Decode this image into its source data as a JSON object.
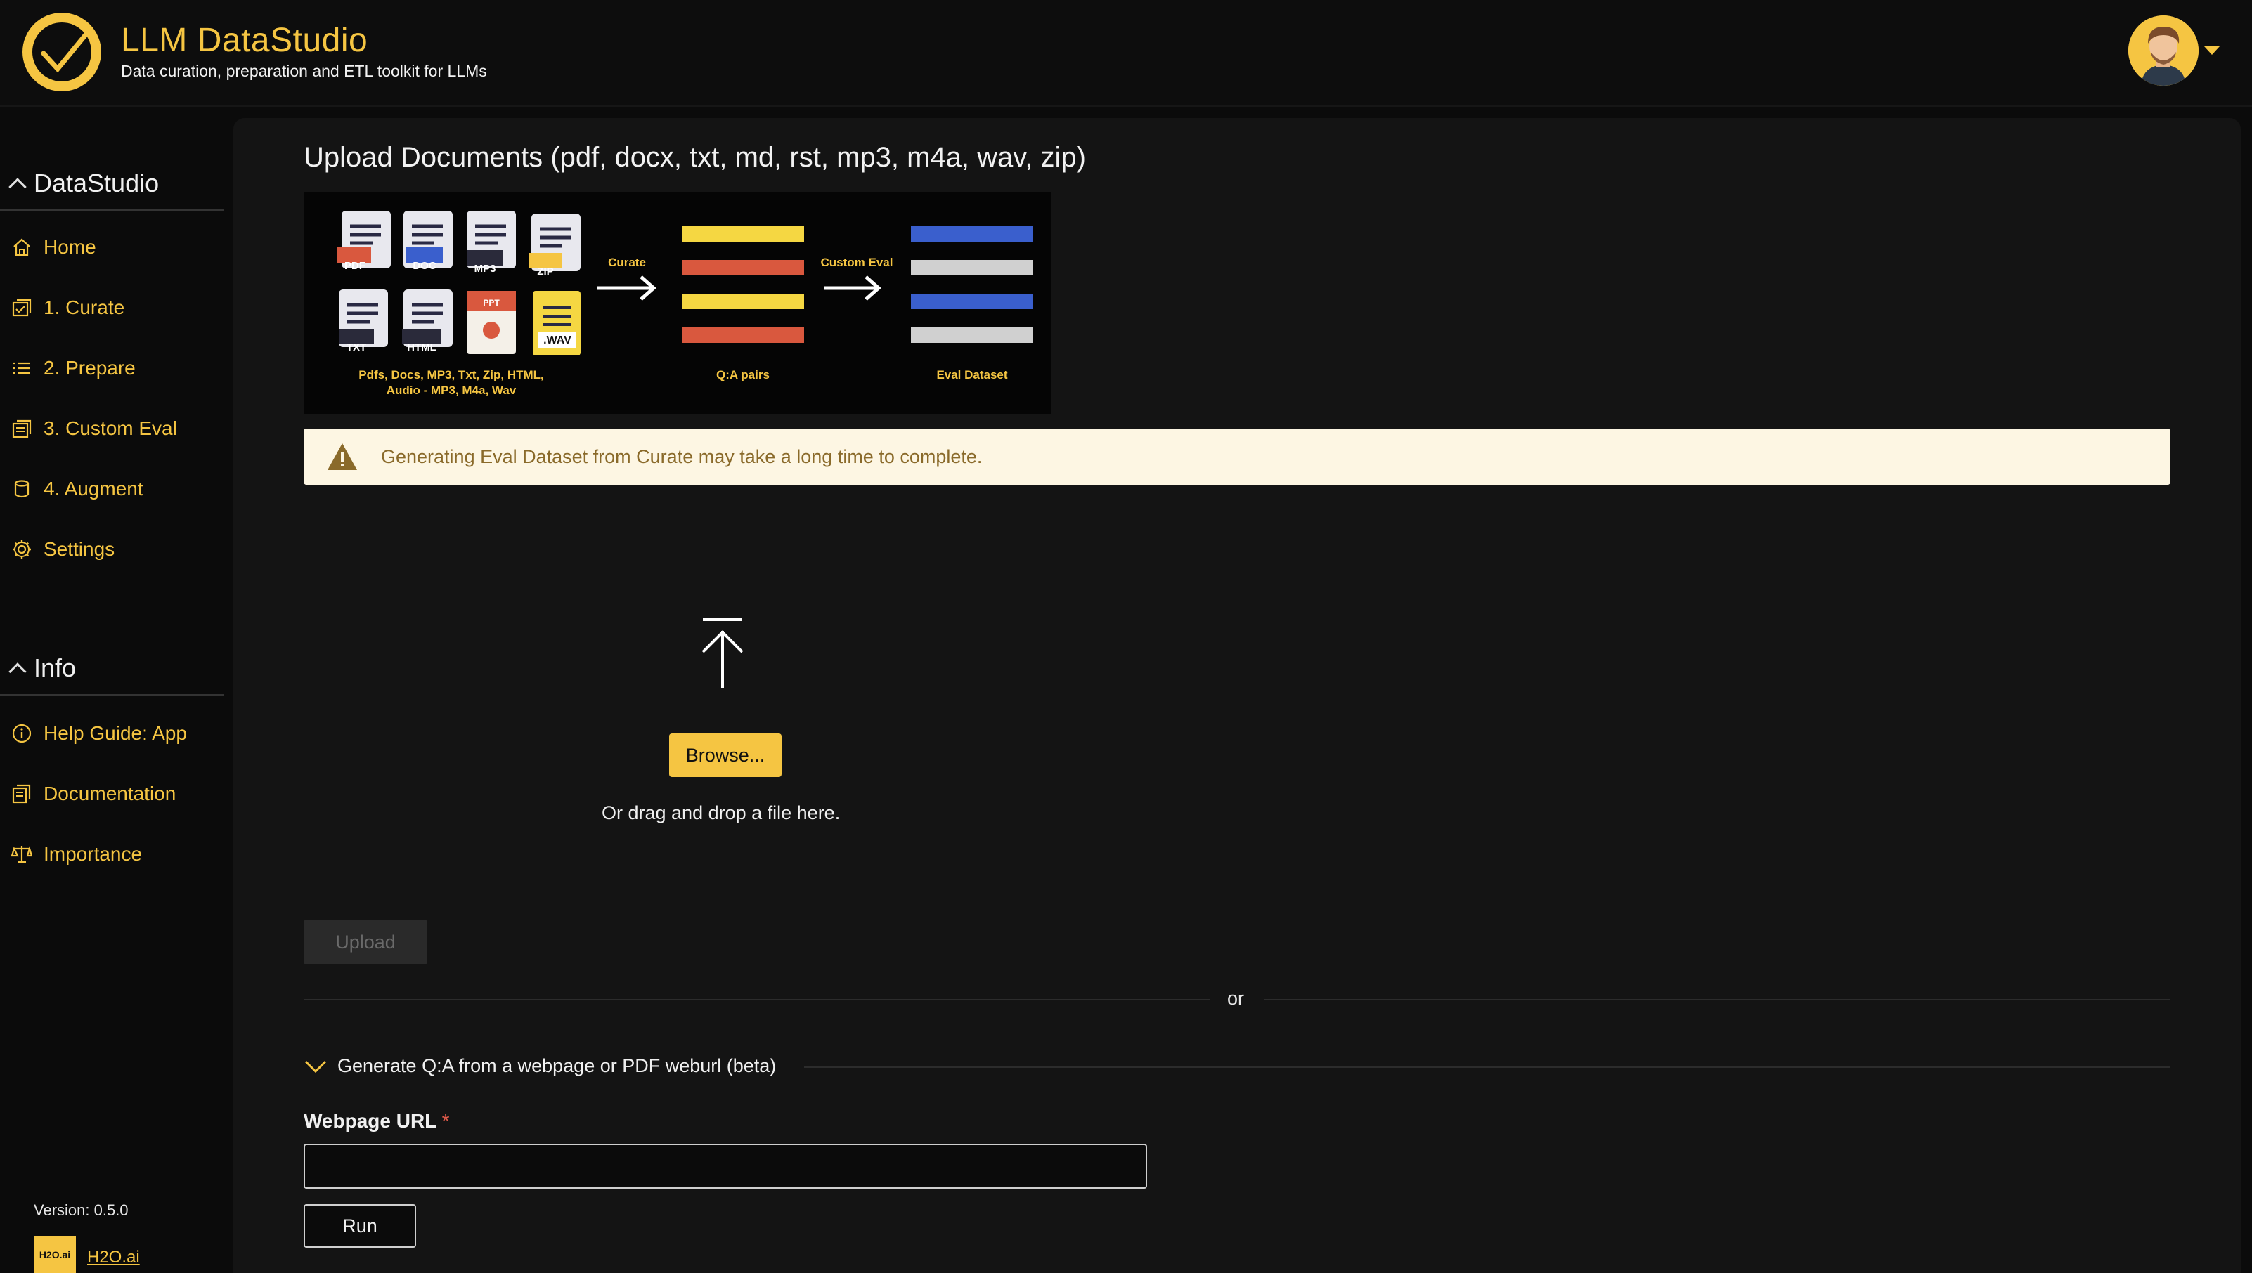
{
  "header": {
    "title": "LLM DataStudio",
    "subtitle": "Data curation, preparation and ETL toolkit for LLMs"
  },
  "sidebar": {
    "sections": [
      {
        "title": "DataStudio",
        "items": [
          {
            "label": "Home",
            "icon": "home-icon"
          },
          {
            "label": "1. Curate",
            "icon": "curate-icon"
          },
          {
            "label": "2. Prepare",
            "icon": "list-icon"
          },
          {
            "label": "3. Custom Eval",
            "icon": "eval-icon"
          },
          {
            "label": "4. Augment",
            "icon": "database-icon"
          },
          {
            "label": "Settings",
            "icon": "gear-icon"
          }
        ]
      },
      {
        "title": "Info",
        "items": [
          {
            "label": "Help Guide: App",
            "icon": "info-icon"
          },
          {
            "label": "Documentation",
            "icon": "document-icon"
          },
          {
            "label": "Importance",
            "icon": "scale-icon"
          }
        ]
      }
    ],
    "version": "Version: 0.5.0",
    "brand_badge": "H2O.ai",
    "brand_link": "H2O.ai"
  },
  "main": {
    "title": "Upload Documents (pdf, docx, txt, md, rst, mp3, m4a, wav, zip)",
    "banner": {
      "file_tags": [
        "PDF",
        "DOC",
        "MP3",
        "ZIP",
        "TXT",
        "HTML",
        "PPT",
        ".WAV"
      ],
      "arrow1": "Curate",
      "arrow2": "Custom Eval",
      "caption_sources": "Pdfs, Docs, MP3, Txt, Zip, HTML,",
      "caption_sources2": "Audio - MP3, M4a, Wav",
      "caption_pairs": "Q:A pairs",
      "caption_eval": "Eval Dataset",
      "colors": {
        "yellow": "#f5d742",
        "red": "#d9583e",
        "blue": "#3a5fcd",
        "gray": "#d0d0d0"
      }
    },
    "warning": "Generating Eval Dataset from Curate may take a long time to complete.",
    "dropzone": {
      "browse_label": "Browse...",
      "hint": "Or drag and drop a file here."
    },
    "upload_label": "Upload",
    "divider_text": "or",
    "generate_toggle": "Generate Q:A from a webpage or PDF weburl (beta)",
    "url_field": {
      "label": "Webpage URL",
      "required_mark": "*",
      "value": "",
      "placeholder": ""
    },
    "run_label": "Run"
  },
  "colors": {
    "accent": "#f5c542",
    "background": "#0b0b0b",
    "card": "#141414",
    "warning_bg": "#fdf6e3"
  }
}
